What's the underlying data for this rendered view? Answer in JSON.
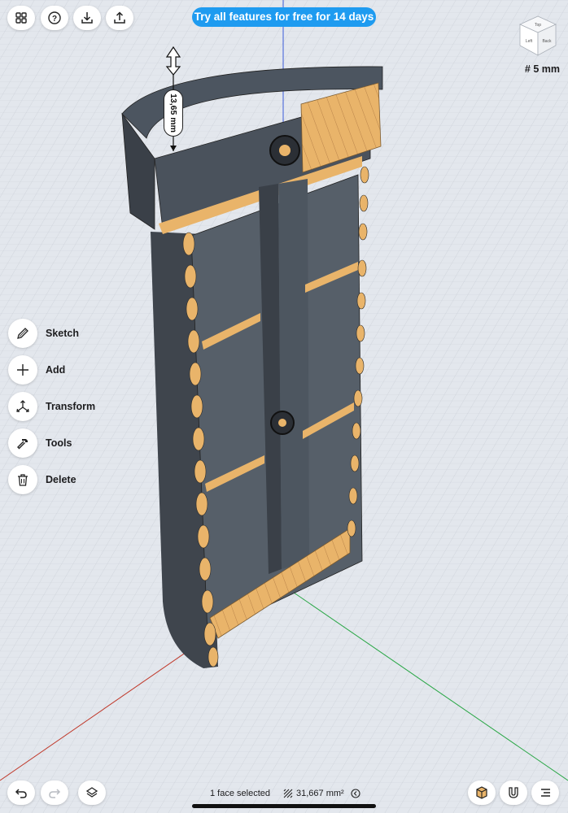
{
  "top_bar": {
    "buttons": [
      {
        "name": "grid-menu-icon"
      },
      {
        "name": "help-icon"
      },
      {
        "name": "import-icon"
      },
      {
        "name": "export-icon"
      }
    ],
    "trial_banner": "Try all features for free for 14 days"
  },
  "view_cube": {
    "faces": [
      "Top",
      "Left",
      "Back"
    ],
    "grid_size": "5 mm",
    "grid_icon": "#"
  },
  "tools": [
    {
      "label": "Sketch",
      "icon": "pencil-icon"
    },
    {
      "label": "Add",
      "icon": "plus-icon"
    },
    {
      "label": "Transform",
      "icon": "transform-icon"
    },
    {
      "label": "Tools",
      "icon": "hammer-icon"
    },
    {
      "label": "Delete",
      "icon": "trash-icon"
    }
  ],
  "dimension": {
    "value": "13,65 mm"
  },
  "status": {
    "selection": "1 face selected",
    "area": "31,667 mm²"
  },
  "bottom_bar": {
    "left": [
      "undo-icon",
      "redo-icon",
      "layers-icon"
    ],
    "right": [
      "material-box-icon",
      "magnet-icon",
      "menu-icon"
    ]
  },
  "colors": {
    "accent": "#1e9bf0",
    "body": "#4a525c",
    "body_dark": "#3a4048",
    "cut_face": "#e9b46a",
    "background": "#dfe3ea",
    "grid_line": "#c7cdd6"
  }
}
